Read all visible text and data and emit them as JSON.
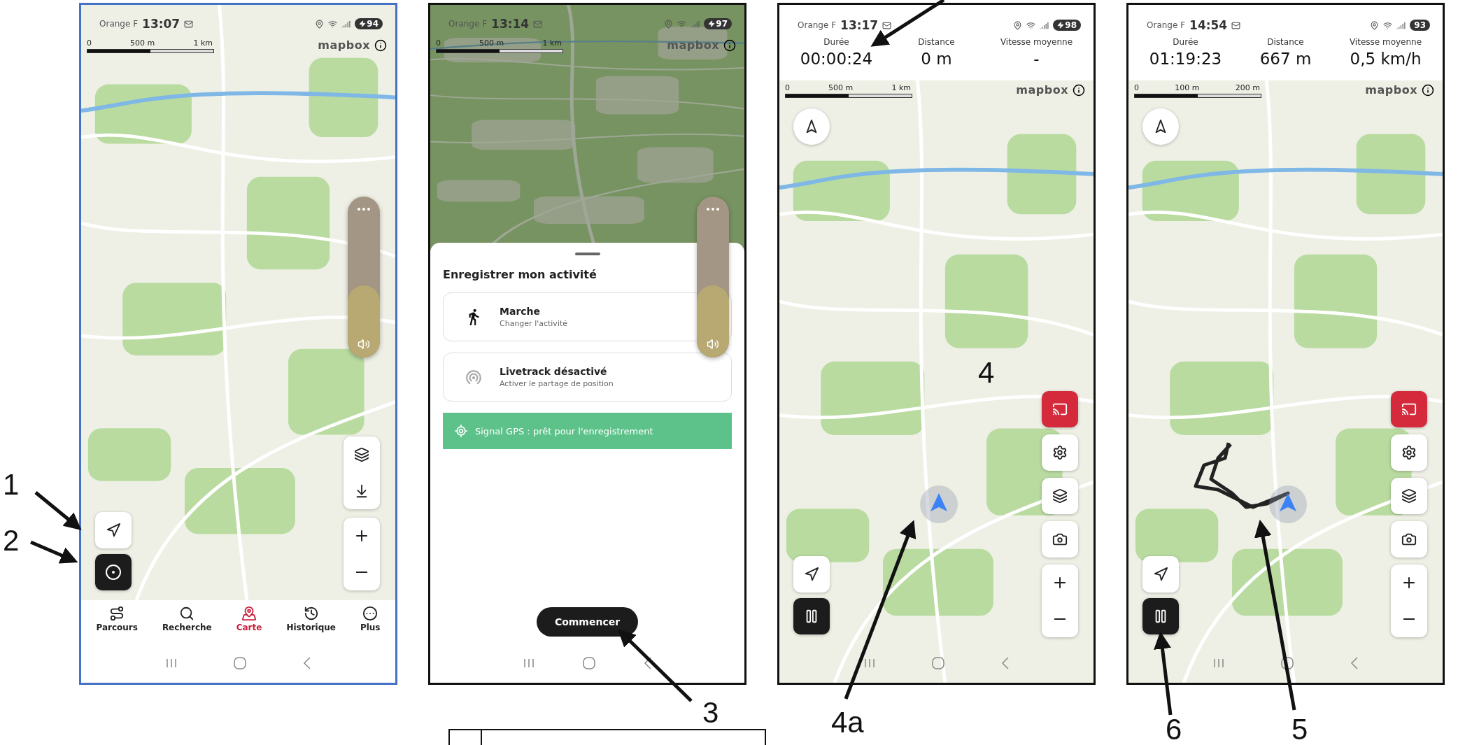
{
  "screens": [
    {
      "kind": "map",
      "status_bar": {
        "carrier": "Orange F",
        "time": "13:07",
        "battery": "94",
        "charging": true
      },
      "scale_bar": [
        "0",
        "500 m",
        "1 km"
      ],
      "attribution": "mapbox",
      "volume": {
        "level": 0.45
      },
      "tabs": [
        {
          "label": "Parcours",
          "selected": false
        },
        {
          "label": "Recherche",
          "selected": false
        },
        {
          "label": "Carte",
          "selected": true
        },
        {
          "label": "Historique",
          "selected": false
        },
        {
          "label": "Plus",
          "selected": false
        }
      ]
    },
    {
      "kind": "sheet",
      "status_bar": {
        "carrier": "Orange F",
        "time": "13:14",
        "battery": "97",
        "charging": true
      },
      "scale_bar": [
        "0",
        "500 m",
        "1 km"
      ],
      "attribution": "mapbox",
      "volume": {
        "level": 0.45
      },
      "sheet": {
        "title": "Enregistrer mon activité",
        "options": [
          {
            "kind": "activity",
            "title": "Marche",
            "subtitle": "Changer l'activité"
          },
          {
            "kind": "livetrack",
            "title": "Livetrack désactivé",
            "subtitle": "Activer le partage de position"
          }
        ],
        "banner": "Signal GPS : prêt pour l'enregistrement",
        "button": "Commencer"
      }
    },
    {
      "kind": "tracking",
      "status_bar": {
        "carrier": "Orange F",
        "time": "13:17",
        "battery": "98",
        "charging": true
      },
      "scale_bar": [
        "0",
        "500 m",
        "1 km"
      ],
      "attribution": "mapbox",
      "track": false,
      "stats": [
        {
          "label": "Durée",
          "value": "00:00:24"
        },
        {
          "label": "Distance",
          "value": "0 m"
        },
        {
          "label": "Vitesse moyenne",
          "value": "-"
        }
      ]
    },
    {
      "kind": "tracking",
      "status_bar": {
        "carrier": "Orange F",
        "time": "14:54",
        "battery": "93",
        "charging": false
      },
      "scale_bar": [
        "0",
        "100 m",
        "200 m"
      ],
      "attribution": "mapbox",
      "track": true,
      "stats": [
        {
          "label": "Durée",
          "value": "01:19:23"
        },
        {
          "label": "Distance",
          "value": "667 m"
        },
        {
          "label": "Vitesse moyenne",
          "value": "0,5 km/h"
        }
      ]
    }
  ],
  "annotations": [
    {
      "label": "1"
    },
    {
      "label": "2"
    },
    {
      "label": "3"
    },
    {
      "label": "4"
    },
    {
      "label": "4a"
    },
    {
      "label": "6"
    },
    {
      "label": "5"
    }
  ]
}
